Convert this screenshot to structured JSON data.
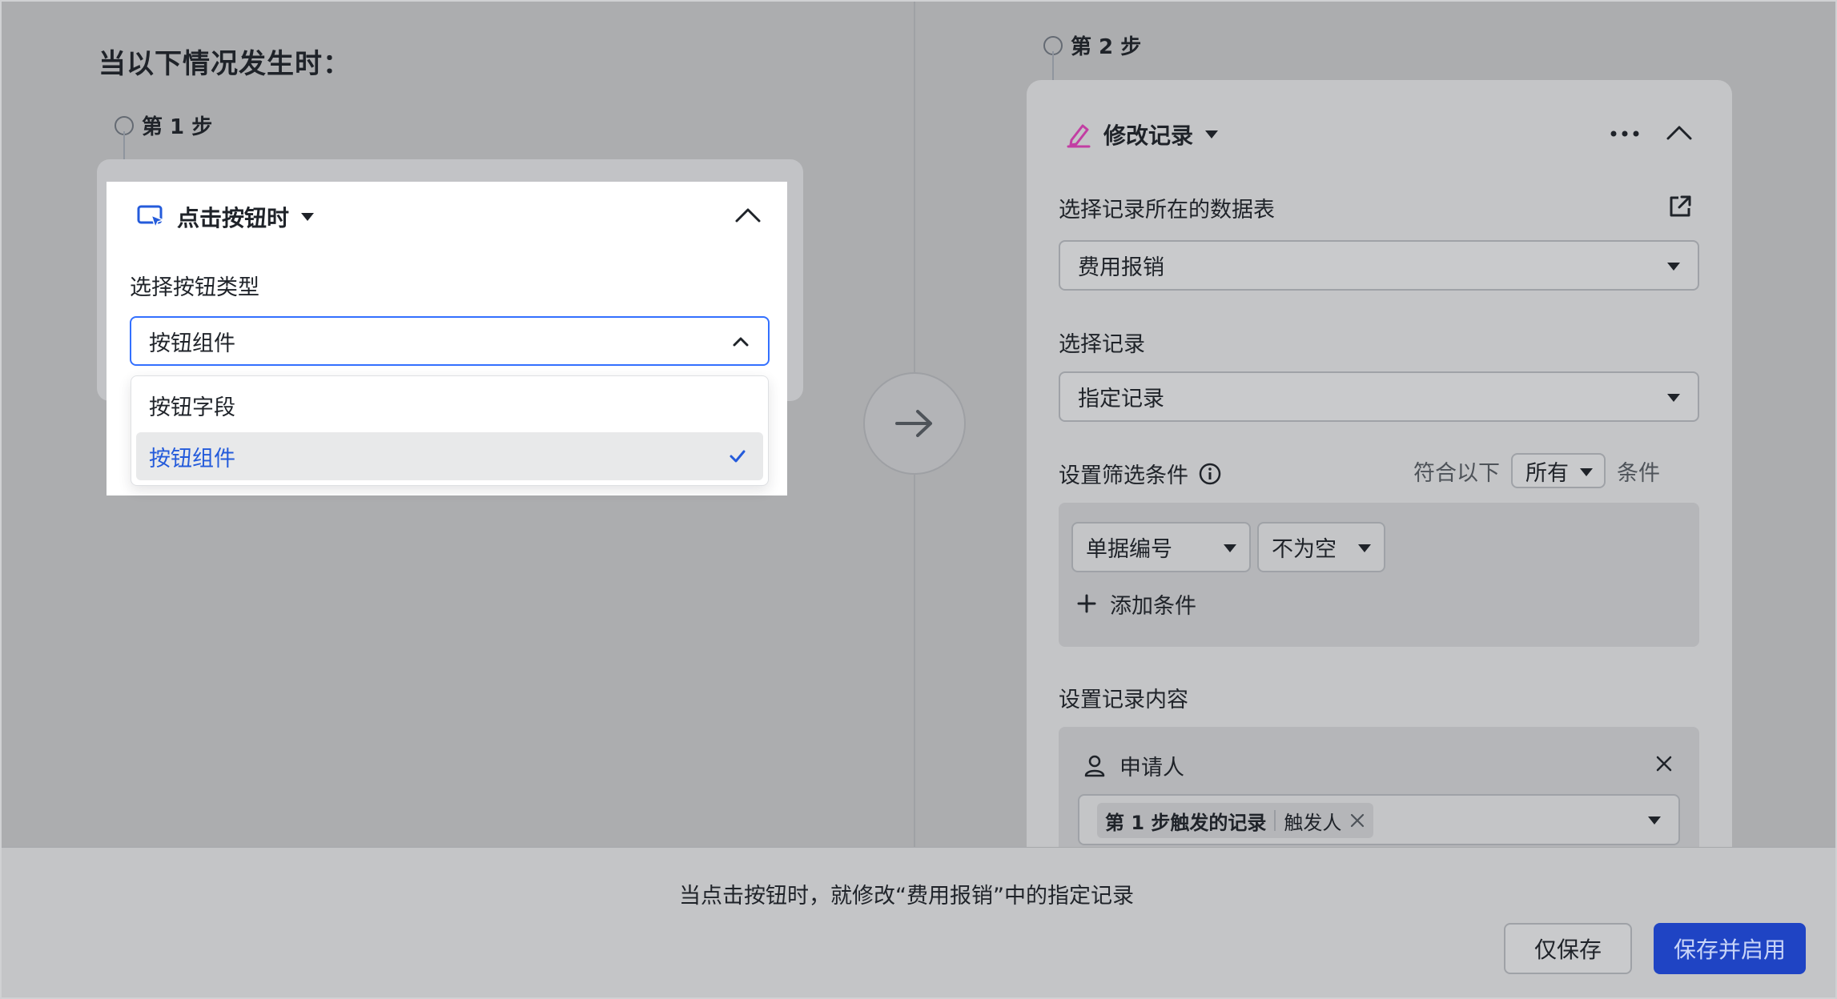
{
  "trigger_section": {
    "heading": "当以下情况发生时：",
    "step_label": "第 1 步",
    "card_title": "点击按钮时",
    "field_label": "选择按钮类型",
    "select_value": "按钮组件",
    "options": [
      {
        "label": "按钮字段",
        "selected": false
      },
      {
        "label": "按钮组件",
        "selected": true
      }
    ]
  },
  "action_section": {
    "step_label": "第 2 步",
    "card_title": "修改记录",
    "table_label": "选择记录所在的数据表",
    "table_value": "费用报销",
    "record_label": "选择记录",
    "record_value": "指定记录",
    "filter_label": "设置筛选条件",
    "match_prefix": "符合以下",
    "match_value": "所有",
    "match_suffix": "条件",
    "filter_field": "单据编号",
    "filter_operator": "不为空",
    "add_condition": "添加条件",
    "content_label": "设置记录内容",
    "content_field": "申请人",
    "tag_source": "第 1 步触发的记录",
    "tag_value": "触发人"
  },
  "footer": {
    "summary": "当点击按钮时，就修改“费用报销”中的指定记录",
    "save_label": "仅保存",
    "save_enable_label": "保存并启用"
  },
  "colors": {
    "accent": "#3370ff",
    "primary_button": "#1f44c4",
    "edit_icon": "#c23ea3"
  }
}
